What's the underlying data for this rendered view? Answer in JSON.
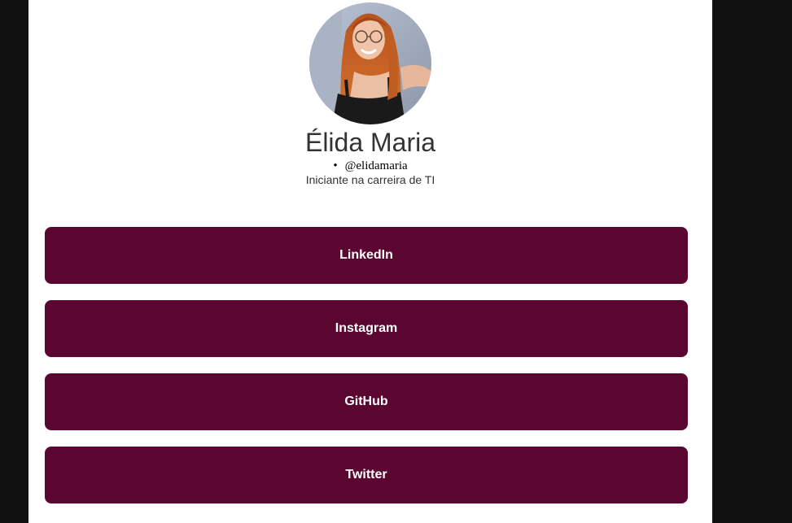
{
  "profile": {
    "name": "Élida Maria",
    "handle": "@elidamaria",
    "bio": "Iniciante na carreira de TI"
  },
  "links": [
    {
      "label": "LinkedIn"
    },
    {
      "label": "Instagram"
    },
    {
      "label": "GitHub"
    },
    {
      "label": "Twitter"
    }
  ],
  "colors": {
    "background": "#111111",
    "card": "#ffffff",
    "button": "#5a0630",
    "button_text": "#ffffff"
  }
}
